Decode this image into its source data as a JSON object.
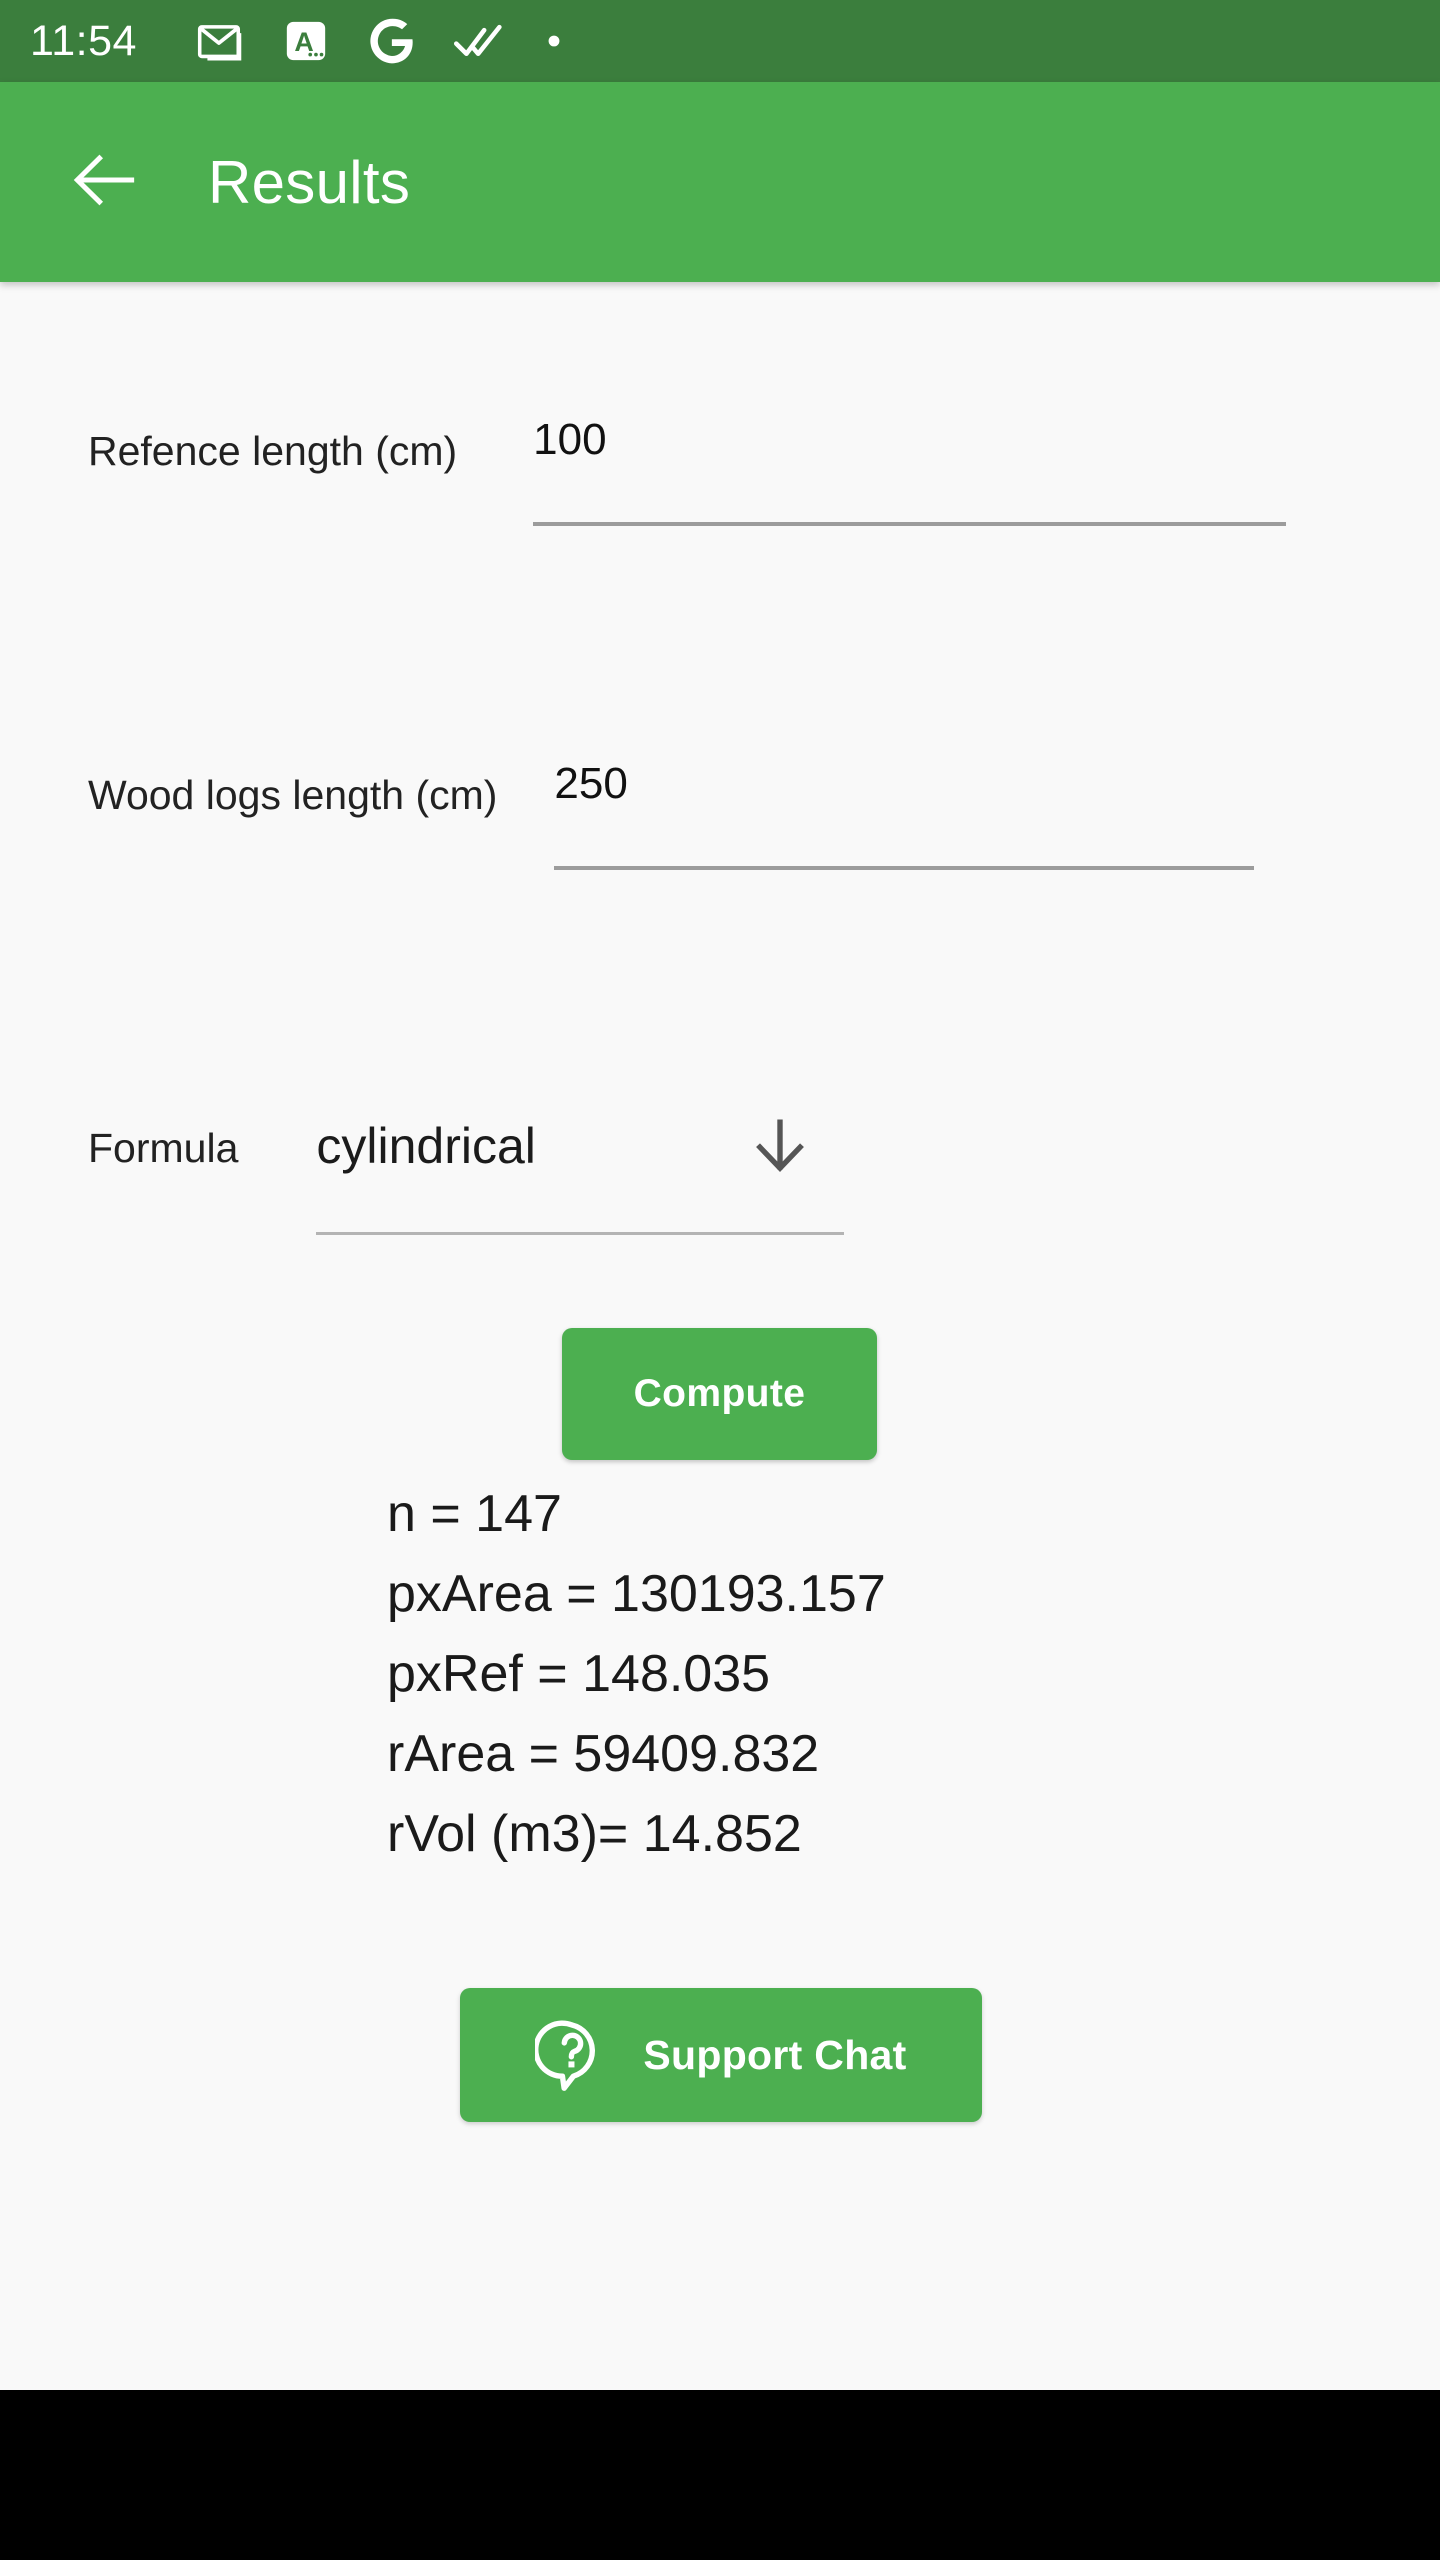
{
  "status_bar": {
    "clock": "11:54",
    "background": "#3B7E3D",
    "icons": [
      {
        "name": "gmail-icon"
      },
      {
        "name": "translate-a-icon",
        "glyph": "A"
      },
      {
        "name": "google-g-icon",
        "glyph": "G"
      },
      {
        "name": "double-check-icon"
      },
      {
        "name": "dot-icon"
      }
    ]
  },
  "app_bar": {
    "title": "Results",
    "back_icon": "arrow-left-icon",
    "background": "#4CAF50",
    "text_color": "#FFFFFF"
  },
  "form": {
    "reference": {
      "label": "Refence length (cm)",
      "value": "100",
      "placeholder": ""
    },
    "wood_logs": {
      "label": "Wood logs length (cm)",
      "value": "250",
      "placeholder": ""
    },
    "formula": {
      "label": "Formula",
      "value": "cylindrical",
      "arrow_icon": "arrow-down-icon",
      "options": [
        "cylindrical"
      ]
    }
  },
  "actions": {
    "compute_label": "Compute",
    "support_chat_label": "Support Chat",
    "support_chat_icon": "question-chat-bubble-icon",
    "button_color": "#4CAF50"
  },
  "results": {
    "lines": [
      "n = 147",
      "pxArea = 130193.157",
      "pxRef = 148.035",
      "rArea = 59409.832",
      "rVol (m3)= 14.852"
    ],
    "values": {
      "n": 147,
      "pxArea": 130193.157,
      "pxRef": 148.035,
      "rArea": 59409.832,
      "rVol_m3": 14.852
    }
  },
  "nav_bar": {
    "background": "#000000"
  }
}
